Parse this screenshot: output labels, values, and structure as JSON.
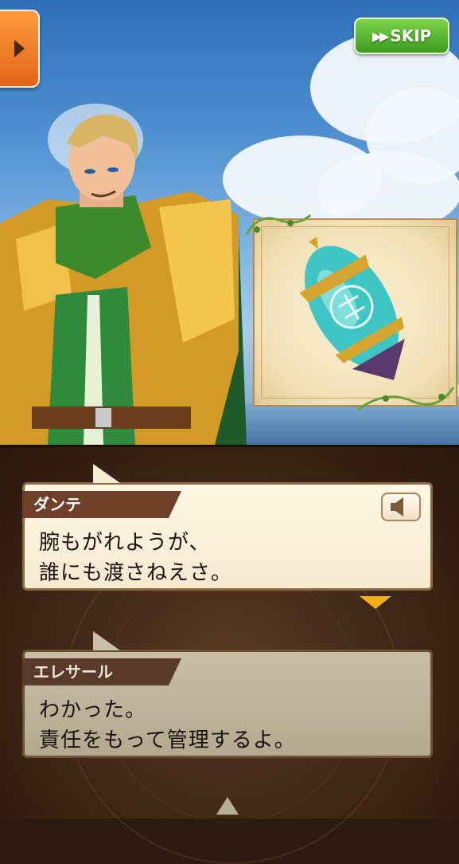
{
  "controls": {
    "menu_icon": "chevron-right-icon",
    "skip_icon": "fast-forward-icon",
    "skip_label": "SKIP"
  },
  "scene": {
    "character": "golden-armored-knight",
    "item_icon": "crystal-relic-icon"
  },
  "dialogue": [
    {
      "speaker": "ダンテ",
      "text": "腕もがれようが、\n誰にも渡さねえさ。",
      "state": "active",
      "voice_icon": "speaker-icon"
    },
    {
      "speaker": "エレサール",
      "text": "わかった。\n責任をもって管理するよ。",
      "state": "inactive"
    }
  ],
  "colors": {
    "skip_button": "#3b9b1f",
    "menu_button": "#e2641a",
    "nameplate": "#6f3f2a",
    "next_indicator": "#f2b216"
  }
}
